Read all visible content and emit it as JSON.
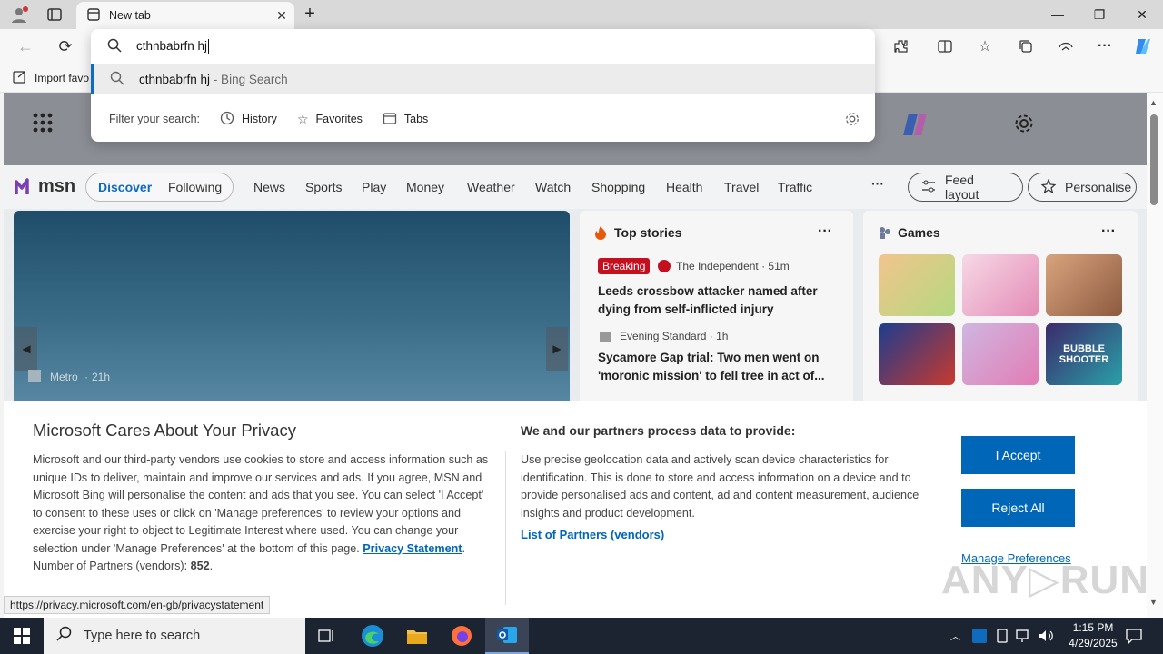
{
  "browser": {
    "tab_title": "New tab",
    "tab_close": "✕",
    "new_tab": "+",
    "window_controls": {
      "minimize": "—",
      "restore": "❐",
      "close": "✕"
    }
  },
  "toolbar": {
    "back": "←",
    "reload": "⟳",
    "icons": [
      "extensions-icon",
      "split-screen-icon",
      "favorites-icon",
      "collections-icon",
      "performance-icon",
      "more-icon",
      "copilot-icon"
    ]
  },
  "favorites_bar": {
    "import_label": "Import favo"
  },
  "omnibox": {
    "query": "cthnbabrfn hj",
    "suggestion_text": "cthnbabrfn hj",
    "suggestion_suffix": " - Bing Search",
    "filter_label": "Filter your search:",
    "filters": [
      "History",
      "Favorites",
      "Tabs"
    ]
  },
  "msn": {
    "logo": "msn",
    "nav": [
      "Discover",
      "Following",
      "News",
      "Sports",
      "Play",
      "Money",
      "Weather",
      "Watch",
      "Shopping",
      "Health",
      "Travel",
      "Traffic"
    ],
    "more": "···",
    "feed_layout": "Feed layout",
    "personalise": "Personalise",
    "hero": {
      "source": "Metro",
      "time": "21h"
    },
    "top_stories": {
      "title": "Top stories",
      "items": [
        {
          "badge": "Breaking",
          "source": "The Independent · 51m",
          "headline": "Leeds crossbow attacker named after dying from self-inflicted injury"
        },
        {
          "source": "Evening Standard · 1h",
          "headline": "Sycamore Gap trial: Two men went on 'moronic mission' to fell tree in act of..."
        }
      ]
    },
    "games": {
      "title": "Games",
      "tile_label": "BUBBLE SHOOTER"
    }
  },
  "privacy": {
    "title": "Microsoft Cares About Your Privacy",
    "body": "Microsoft and our third-party vendors use cookies to store and access information such as unique IDs to deliver, maintain and improve our services and ads. If you agree, MSN and Microsoft Bing will personalise the content and ads that you see. You can select 'I Accept' to consent to these uses or click on 'Manage preferences' to review your options and exercise your right to object to Legitimate Interest where used.  You can change your selection under 'Manage Preferences' at the bottom of this page.",
    "privacy_link": "Privacy Statement",
    "partners_count_label": "Number of Partners (vendors):",
    "partners_count": "852",
    "right_title": "We and our partners process data to provide:",
    "right_body": "Use precise geolocation data and actively scan device characteristics for identification. This is done to store and access information on a device and to provide personalised ads and content, ad and content measurement, audience insights and product development.",
    "partners_link": "List of Partners (vendors)",
    "accept": "I Accept",
    "reject": "Reject All",
    "manage": "Manage Preferences",
    "watermark": "ANY▷RUN"
  },
  "status_url": "https://privacy.microsoft.com/en-gb/privacystatement",
  "taskbar": {
    "search_placeholder": "Type here to search",
    "time": "1:15 PM",
    "date": "4/29/2025"
  },
  "colors": {
    "accent": "#0067b8",
    "breaking": "#c50f1f",
    "taskbar": "#1c2431"
  }
}
